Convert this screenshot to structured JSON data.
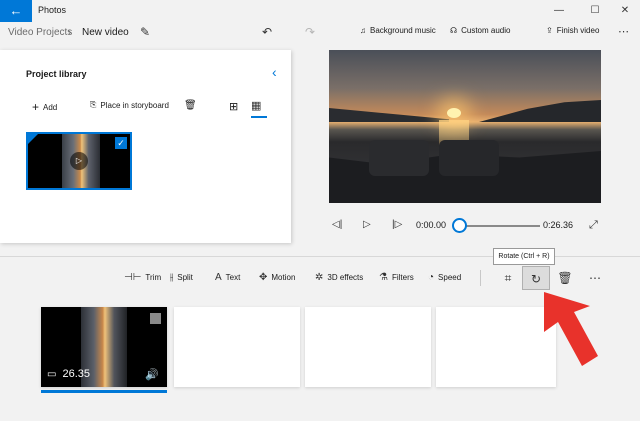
{
  "window": {
    "app_title": "Photos",
    "back_icon": "back-arrow-icon",
    "minimize": "—",
    "maximize": "☐",
    "close": "✕"
  },
  "header": {
    "breadcrumb_root": "Video Projects",
    "breadcrumb_separator": "›",
    "project_name": "New video",
    "background_music": "Background music",
    "custom_audio": "Custom audio",
    "finish_video": "Finish video",
    "more": "⋯"
  },
  "library": {
    "title": "Project library",
    "add": "Add",
    "place_in_storyboard": "Place in storyboard"
  },
  "player": {
    "current_time": "0:00.00",
    "total_time": "0:26.36",
    "progress": 0
  },
  "toolbar": {
    "trim": "Trim",
    "split": "Split",
    "text": "Text",
    "motion": "Motion",
    "effects_3d": "3D effects",
    "filters": "Filters",
    "speed": "Speed",
    "more": "⋯",
    "rotate_tooltip": "Rotate (Ctrl + R)"
  },
  "storyboard": {
    "clips": [
      {
        "duration": "26.35",
        "filled": true,
        "selected": true
      },
      {
        "filled": false
      },
      {
        "filled": false
      },
      {
        "filled": false
      }
    ]
  },
  "colors": {
    "accent": "#0078d7",
    "annotation_arrow": "#e8322b"
  }
}
